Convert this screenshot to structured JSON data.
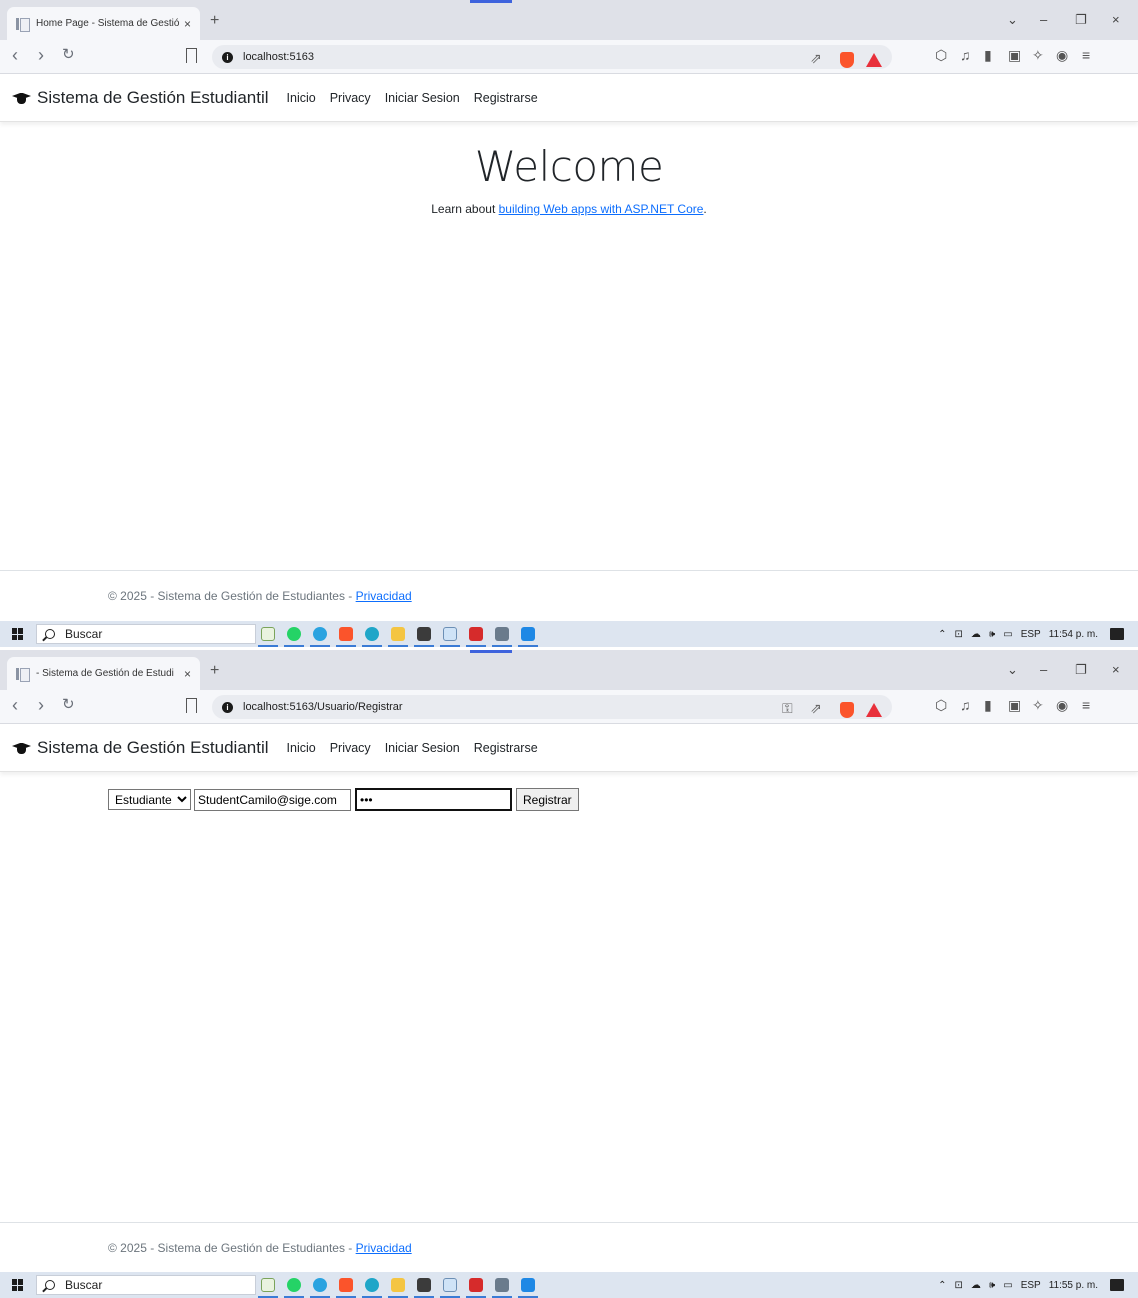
{
  "screenshots": [
    {
      "tab": {
        "title": "Home Page - Sistema de Gestió",
        "close": "×",
        "new": "+"
      },
      "window_controls": [
        "⌄",
        "–",
        "❐",
        "×"
      ],
      "url": "localhost:5163",
      "navbar": {
        "brand": "Sistema de Gestión Estudiantil",
        "links": [
          "Inicio",
          "Privacy",
          "Iniciar Sesion",
          "Registrarse"
        ]
      },
      "main": {
        "heading": "Welcome",
        "learn_prefix": "Learn about ",
        "learn_link": "building Web apps with ASP.NET Core",
        "learn_suffix": "."
      },
      "footer": {
        "text": "© 2025 - Sistema de Gestión de Estudiantes - ",
        "link": "Privacidad"
      },
      "taskbar": {
        "search": "Buscar",
        "lang": "ESP",
        "time": "11:54 p. m."
      }
    },
    {
      "tab": {
        "title": " - Sistema de Gestión de Estudi",
        "close": "×",
        "new": "+"
      },
      "window_controls": [
        "⌄",
        "–",
        "❐",
        "×"
      ],
      "url": "localhost:5163/Usuario/Registrar",
      "navbar": {
        "brand": "Sistema de Gestión Estudiantil",
        "links": [
          "Inicio",
          "Privacy",
          "Iniciar Sesion",
          "Registrarse"
        ]
      },
      "form": {
        "role_selected": "Estudiante",
        "email_value": "StudentCamilo@sige.com",
        "password_value": "•••",
        "submit_label": "Registrar"
      },
      "footer": {
        "text": "© 2025 - Sistema de Gestión de Estudiantes - ",
        "link": "Privacidad"
      },
      "taskbar": {
        "search": "Buscar",
        "lang": "ESP",
        "time": "11:55 p. m."
      }
    }
  ],
  "colors": {
    "link": "#0d6efd",
    "tabstrip": "#dfe1e8",
    "toolbar": "#f6f7fa",
    "taskbar": "#dde5f0",
    "brave_orange": "#fb542b"
  }
}
